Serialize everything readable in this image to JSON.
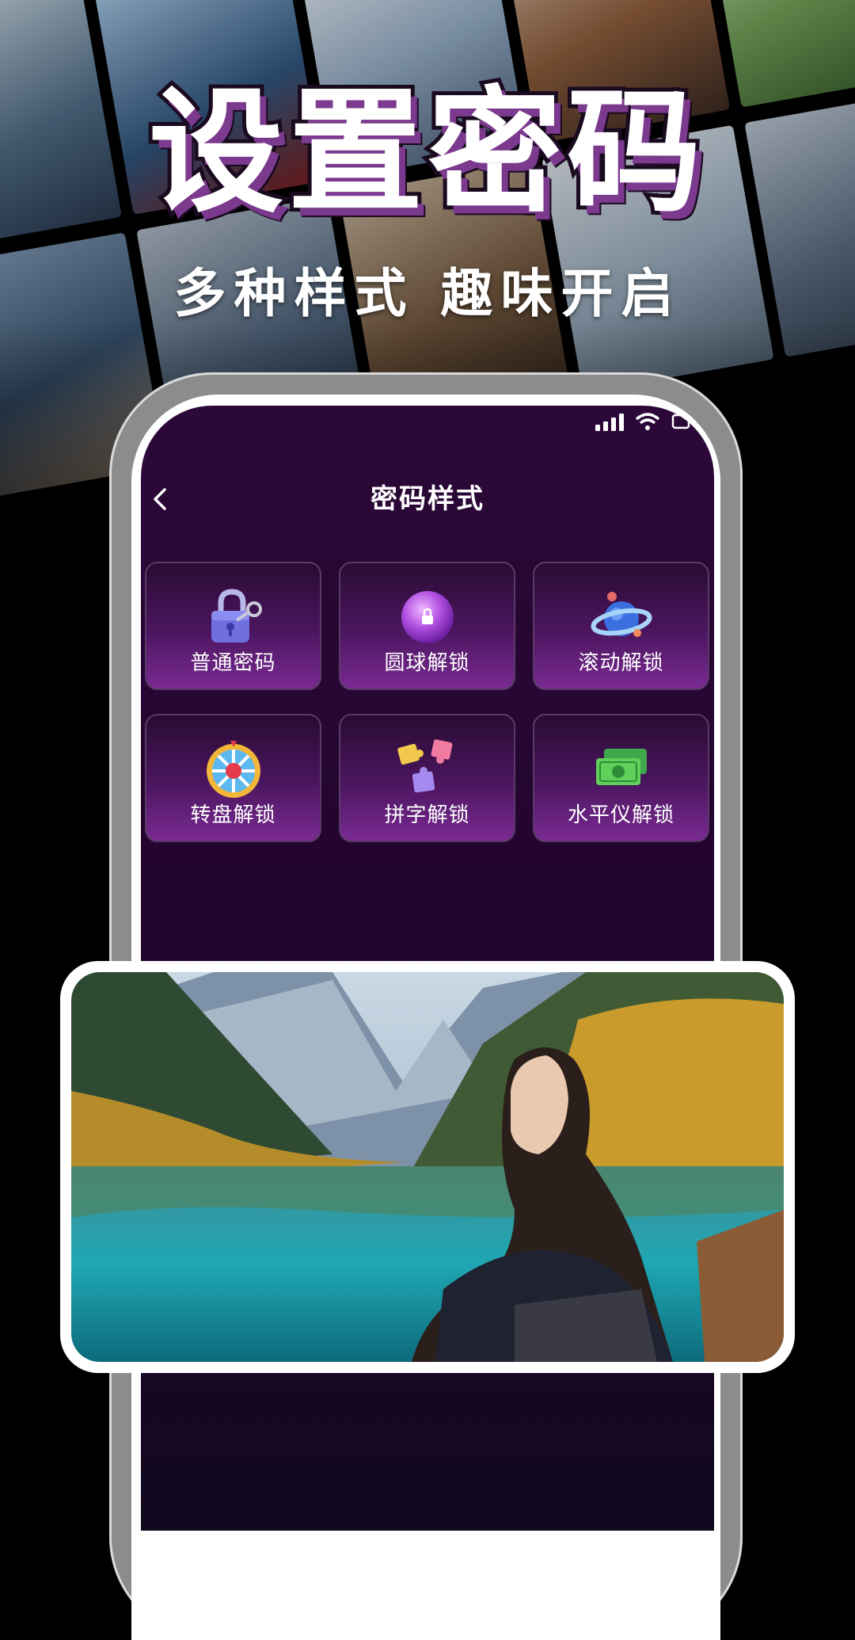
{
  "headline": "设置密码",
  "subline": "多种样式 趣味开启",
  "status_bar": {
    "icons": [
      "signal-icon",
      "wifi-icon",
      "battery-icon"
    ]
  },
  "screen": {
    "back_icon": "chevron-left-icon",
    "title": "密码样式",
    "options": [
      {
        "label": "普通密码",
        "icon": "padlock-key-icon"
      },
      {
        "label": "圆球解锁",
        "icon": "purple-orb-lock-icon"
      },
      {
        "label": "滚动解锁",
        "icon": "planet-ring-icon"
      },
      {
        "label": "转盘解锁",
        "icon": "prize-wheel-icon"
      },
      {
        "label": "拼字解锁",
        "icon": "puzzle-pieces-icon"
      },
      {
        "label": "水平仪解锁",
        "icon": "cash-bills-icon"
      }
    ]
  },
  "colors": {
    "screen_bg": "#230530",
    "card_gradient_bottom": "#7a2a92",
    "headline_shadow": "#7b3a8e"
  }
}
